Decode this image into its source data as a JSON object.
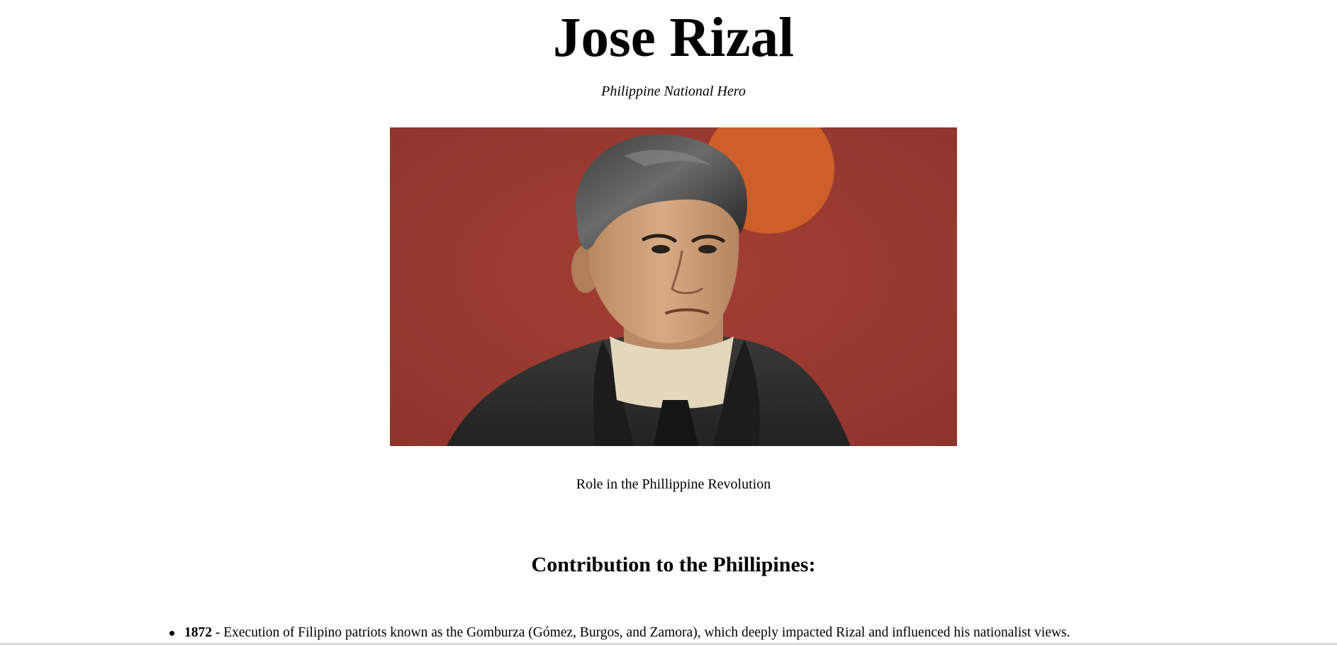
{
  "header": {
    "title": "Jose Rizal",
    "subtitle": "Philippine National Hero"
  },
  "figure": {
    "caption": "Role in the Phillippine Revolution",
    "colors": {
      "background": "#9e3a31",
      "sun": "#d2612a",
      "skin": "#d3a57e",
      "hair": "#2a2a2a",
      "coat": "#2c2c2c",
      "collar": "#e6dcc0"
    }
  },
  "contributions": {
    "heading": "Contribution to the Phillipines:",
    "items": [
      {
        "year": "1872",
        "text": " - Execution of Filipino patriots known as the Gomburza (Gómez, Burgos, and Zamora), which deeply impacted Rizal and influenced his nationalist views."
      }
    ]
  }
}
